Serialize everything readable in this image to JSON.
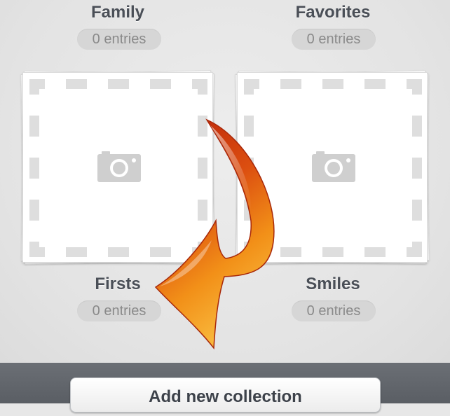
{
  "collections": [
    {
      "name": "Family",
      "entries": "0 entries"
    },
    {
      "name": "Favorites",
      "entries": "0 entries"
    },
    {
      "name": "Firsts",
      "entries": "0 entries"
    },
    {
      "name": "Smiles",
      "entries": "0 entries"
    }
  ],
  "bottom_bar": {
    "add_label": "Add new collection"
  },
  "icons": {
    "placeholder": "camera-icon",
    "annotation": "curved-arrow-icon"
  },
  "colors": {
    "arrow_dark": "#c2290b",
    "arrow_light": "#f7a21b",
    "bottom_bar": "#62666c"
  }
}
